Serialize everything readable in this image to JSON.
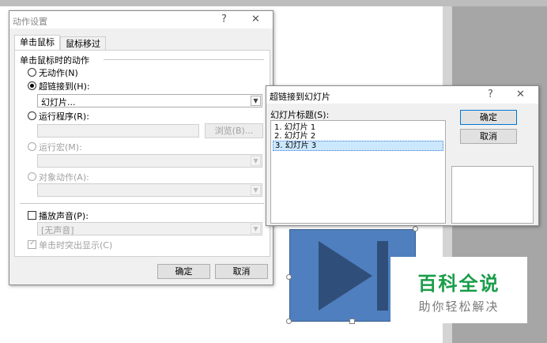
{
  "action_dialog": {
    "title": "动作设置",
    "help_glyph": "?",
    "close_glyph": "✕",
    "tabs": [
      "单击鼠标",
      "鼠标移过"
    ],
    "group_label": "单击鼠标时的动作",
    "radio_none": "无动作(N)",
    "radio_hyperlink": "超链接到(H):",
    "hyperlink_value": "幻灯片...",
    "radio_run_program": "运行程序(R):",
    "browse_label": "浏览(B)...",
    "radio_run_macro": "运行宏(M):",
    "radio_object_action": "对象动作(A):",
    "play_sound_label": "播放声音(P):",
    "sound_value": "[无声音]",
    "highlight_label": "单击时突出显示(C)",
    "ok_label": "确定",
    "cancel_label": "取消"
  },
  "slide_dialog": {
    "title": "超链接到幻灯片",
    "help_glyph": "?",
    "close_glyph": "✕",
    "list_label": "幻灯片标题(S):",
    "slides": [
      "1. 幻灯片 1",
      "2. 幻灯片 2",
      "3. 幻灯片 3"
    ],
    "selected_index": 2,
    "ok_label": "确定",
    "cancel_label": "取消"
  },
  "watermark": {
    "title": "百科全说",
    "subtitle": "助你轻松解决"
  },
  "colors": {
    "shape_fill": "#4f7fbf",
    "shape_icon": "#2f4f7a",
    "watermark_green": "#1a9d4a",
    "default_button_border": "#0078d7"
  },
  "icons": {
    "dropdown": "chevron-down-icon",
    "close": "close-icon",
    "help": "help-icon"
  }
}
